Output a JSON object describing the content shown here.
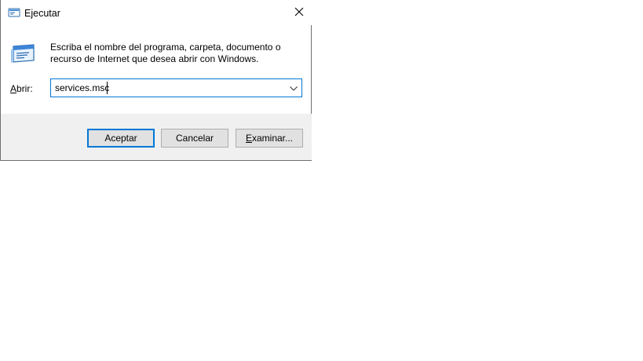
{
  "window": {
    "title": "Ejecutar",
    "icon": "run-icon"
  },
  "message": {
    "line1": "Escriba el nombre del programa, carpeta, documento o",
    "line2": "recurso de Internet que desea abrir con Windows."
  },
  "open_field": {
    "label_accesskey": "A",
    "label_rest": "brir:",
    "value": "services.msc"
  },
  "buttons": {
    "ok": "Aceptar",
    "cancel": "Cancelar",
    "browse_accesskey": "E",
    "browse_rest": "xaminar..."
  },
  "colors": {
    "accent": "#0078d7",
    "footer_bg": "#f0f0f0",
    "button_bg": "#e1e1e1"
  }
}
